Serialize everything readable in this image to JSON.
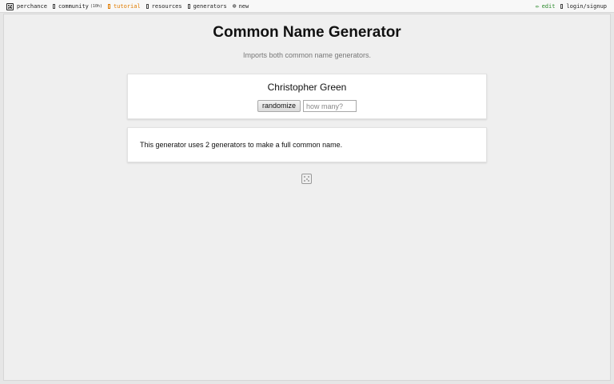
{
  "nav": {
    "brand": "perchance",
    "community": "community",
    "community_count": "(10h)",
    "tutorial": "tutorial",
    "resources": "resources",
    "generators": "generators",
    "new": "new",
    "edit": "edit",
    "login": "login/signup"
  },
  "page": {
    "title": "Common Name Generator",
    "subtitle": "Imports both common name generators."
  },
  "generator": {
    "result": "Christopher Green",
    "randomize_label": "randomize",
    "count_placeholder": "how many?"
  },
  "description": "This generator uses 2 generators to make a full common name.",
  "colors": {
    "tutorial": "#e07b00",
    "edit": "#2c8a2c"
  },
  "icons": [
    "die-icon",
    "community-icon",
    "tutorial-icon",
    "resources-icon",
    "generators-icon",
    "plus-icon",
    "pencil-icon",
    "login-icon"
  ]
}
